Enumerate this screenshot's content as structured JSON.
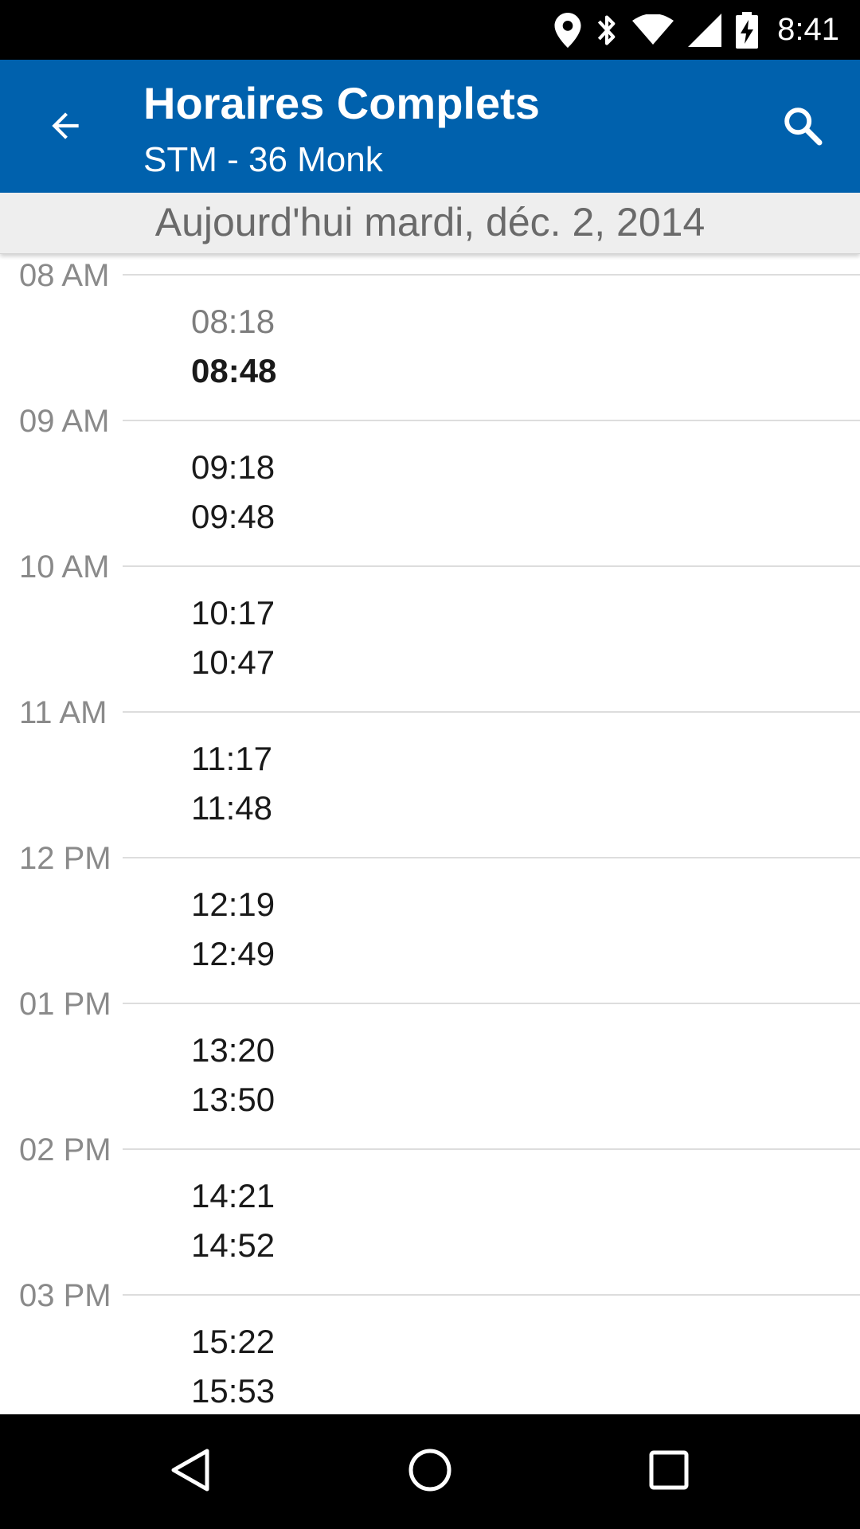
{
  "status_bar": {
    "time": "8:41",
    "icons": [
      "location-icon",
      "bluetooth-icon",
      "wifi-icon",
      "cell-signal-icon",
      "battery-charging-icon"
    ]
  },
  "app_bar": {
    "title": "Horaires Complets",
    "subtitle": "STM - 36 Monk",
    "back_icon": "arrow-back-icon",
    "search_icon": "search-icon"
  },
  "date_header": {
    "text": "Aujourd'hui mardi, déc. 2, 2014"
  },
  "schedule": {
    "hours": [
      {
        "label": "08 AM",
        "times": [
          {
            "time": "08:18",
            "state": "past"
          },
          {
            "time": "08:48",
            "state": "next"
          }
        ]
      },
      {
        "label": "09 AM",
        "times": [
          {
            "time": "09:18",
            "state": "future"
          },
          {
            "time": "09:48",
            "state": "future"
          }
        ]
      },
      {
        "label": "10 AM",
        "times": [
          {
            "time": "10:17",
            "state": "future"
          },
          {
            "time": "10:47",
            "state": "future"
          }
        ]
      },
      {
        "label": "11 AM",
        "times": [
          {
            "time": "11:17",
            "state": "future"
          },
          {
            "time": "11:48",
            "state": "future"
          }
        ]
      },
      {
        "label": "12 PM",
        "times": [
          {
            "time": "12:19",
            "state": "future"
          },
          {
            "time": "12:49",
            "state": "future"
          }
        ]
      },
      {
        "label": "01 PM",
        "times": [
          {
            "time": "13:20",
            "state": "future"
          },
          {
            "time": "13:50",
            "state": "future"
          }
        ]
      },
      {
        "label": "02 PM",
        "times": [
          {
            "time": "14:21",
            "state": "future"
          },
          {
            "time": "14:52",
            "state": "future"
          }
        ]
      },
      {
        "label": "03 PM",
        "times": [
          {
            "time": "15:22",
            "state": "future"
          },
          {
            "time": "15:53",
            "state": "future"
          }
        ]
      }
    ]
  },
  "nav_bar": {
    "icons": [
      "nav-back-icon",
      "nav-home-icon",
      "nav-recents-icon"
    ]
  },
  "colors": {
    "app_bar": "#0061ad",
    "date_bar": "#eeeeee",
    "past_time": "#7d7d7d",
    "time_text": "#1a1a1a",
    "hour_label": "#8a8a8a"
  }
}
